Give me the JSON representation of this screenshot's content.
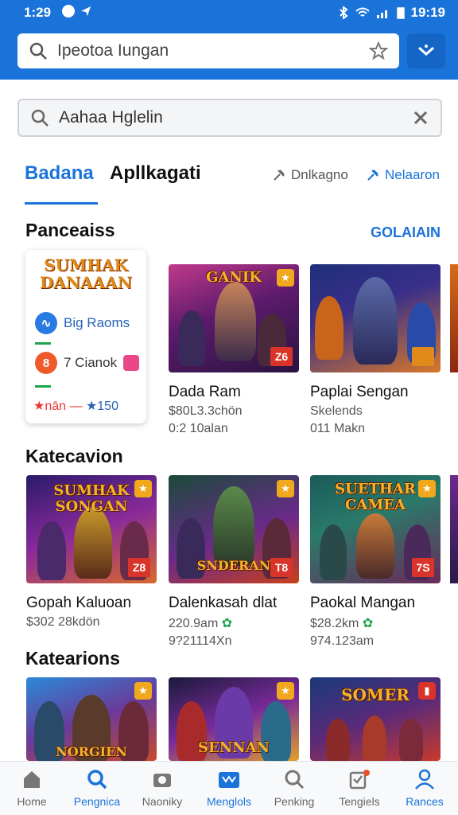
{
  "status": {
    "time": "1:29",
    "clock_right": "19:19"
  },
  "search_main": {
    "placeholder": "Ipeotoa Iungan"
  },
  "search_secondary": {
    "text": "Aahaa Hglelin"
  },
  "tabs": [
    {
      "label": "Badana",
      "active": true
    },
    {
      "label": "Apllkagati",
      "active": false
    }
  ],
  "tab_links": [
    {
      "label": "Dnlkagno"
    },
    {
      "label": "Nelaaron"
    }
  ],
  "sections": [
    {
      "title": "Panceaiss",
      "link": "GOLAIAIN"
    },
    {
      "title": "Katecavion"
    },
    {
      "title": "Katearions"
    }
  ],
  "promo": {
    "logo": "SUMHAK DANAAAN",
    "row1": "Big Raoms",
    "row2": "7 Cianok",
    "bottom_left": "★nān —",
    "bottom_right": "★150"
  },
  "row1_cards": [
    {
      "banner": "GANIK",
      "title": "Dada Ram",
      "line1": "$80L3.3chön",
      "line2": "0:2 10alan",
      "rate": "Z6"
    },
    {
      "banner": "",
      "title": "Paplai Sengan",
      "line1": "Skelends",
      "line2": "011 Makn",
      "rate": ""
    }
  ],
  "row2_cards": [
    {
      "banner": "SUMHAK SONGAN",
      "title": "Gopah Kaluoan",
      "line1": "$302 28kdön",
      "line2": "",
      "rate": "Z8"
    },
    {
      "banner": "SNDERAN",
      "title": "Dalenkasah dlat",
      "line1": "220.9am",
      "line2": "9?21114Xn",
      "rate": "T8"
    },
    {
      "banner": "SUETHAR CAMEA",
      "title": "Paokal Mangan",
      "line1": "$28.2km",
      "line2": "974.123am",
      "rate": "7S"
    }
  ],
  "row3_cards": [
    {
      "banner": "NORGIEN",
      "rate": ""
    },
    {
      "banner": "SENNAN",
      "rate": ""
    },
    {
      "banner": "SOMER",
      "rate": ""
    }
  ],
  "nav": [
    {
      "label": "Home",
      "icon": "home-icon",
      "active": false
    },
    {
      "label": "Pengnica",
      "icon": "search-icon",
      "active": true
    },
    {
      "label": "Naoniky",
      "icon": "camera-icon",
      "active": false
    },
    {
      "label": "Menglols",
      "icon": "grid-icon",
      "active": true
    },
    {
      "label": "Penking",
      "icon": "search-icon",
      "active": false
    },
    {
      "label": "Tengiels",
      "icon": "notes-icon",
      "active": false
    },
    {
      "label": "Rances",
      "icon": "user-icon",
      "active": true
    }
  ],
  "colors": {
    "accent": "#1a73d9",
    "topbar": "#1a73d9",
    "rating": "#d8342a"
  }
}
